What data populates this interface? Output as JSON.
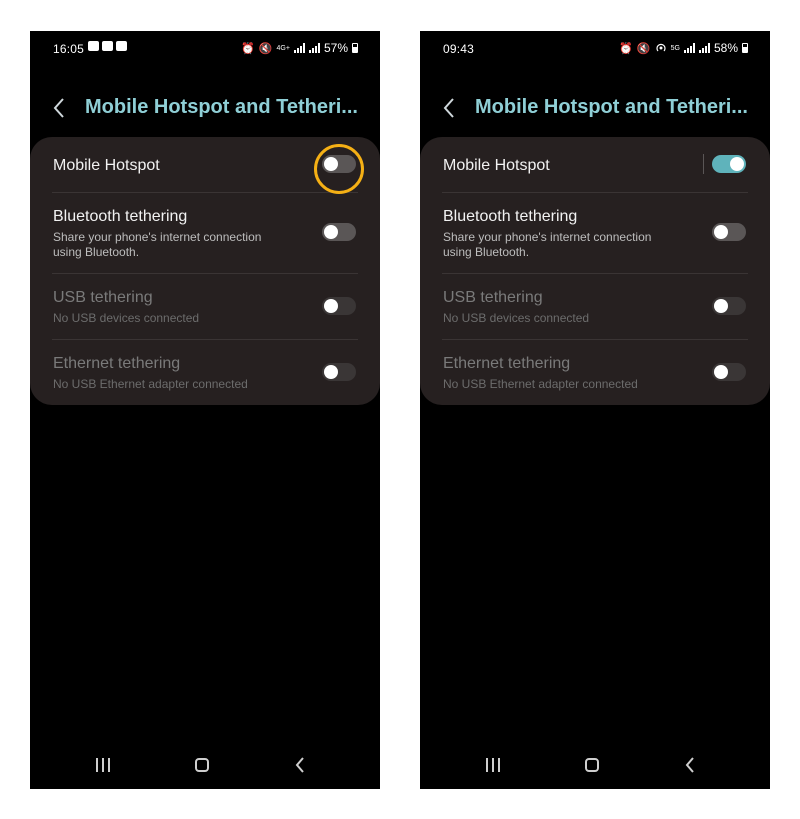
{
  "screens": [
    {
      "status_bar": {
        "time": "16:05",
        "network": "4G+",
        "battery": "57%"
      },
      "header": {
        "title": "Mobile Hotspot and Tetheri..."
      },
      "rows": [
        {
          "title": "Mobile Hotspot",
          "subtitle": "",
          "state": "off"
        },
        {
          "title": "Bluetooth tethering",
          "subtitle": "Share your phone's internet connection using Bluetooth.",
          "state": "off"
        },
        {
          "title": "USB tethering",
          "subtitle": "No USB devices connected",
          "state": "disabled"
        },
        {
          "title": "Ethernet tethering",
          "subtitle": "No USB Ethernet adapter connected",
          "state": "disabled"
        }
      ],
      "annotation": {
        "highlighted": "Mobile Hotspot toggle",
        "color": "#f5b015"
      }
    },
    {
      "status_bar": {
        "time": "09:43",
        "network": "5G",
        "battery": "58%"
      },
      "header": {
        "title": "Mobile Hotspot and Tetheri..."
      },
      "rows": [
        {
          "title": "Mobile Hotspot",
          "subtitle": "",
          "state": "on"
        },
        {
          "title": "Bluetooth tethering",
          "subtitle": "Share your phone's internet connection using Bluetooth.",
          "state": "off"
        },
        {
          "title": "USB tethering",
          "subtitle": "No USB devices connected",
          "state": "disabled"
        },
        {
          "title": "Ethernet tethering",
          "subtitle": "No USB Ethernet adapter connected",
          "state": "disabled"
        }
      ]
    }
  ],
  "theme": {
    "accent": "#8fcfd6",
    "toggle_on": "#5fb3bb",
    "card": "#262020",
    "background": "#000000"
  },
  "icons": [
    "back-arrow-icon",
    "alarm-icon",
    "mute-icon",
    "hotspot-icon",
    "signal-icon",
    "battery-icon",
    "recent-apps-icon",
    "home-icon",
    "nav-back-icon"
  ]
}
